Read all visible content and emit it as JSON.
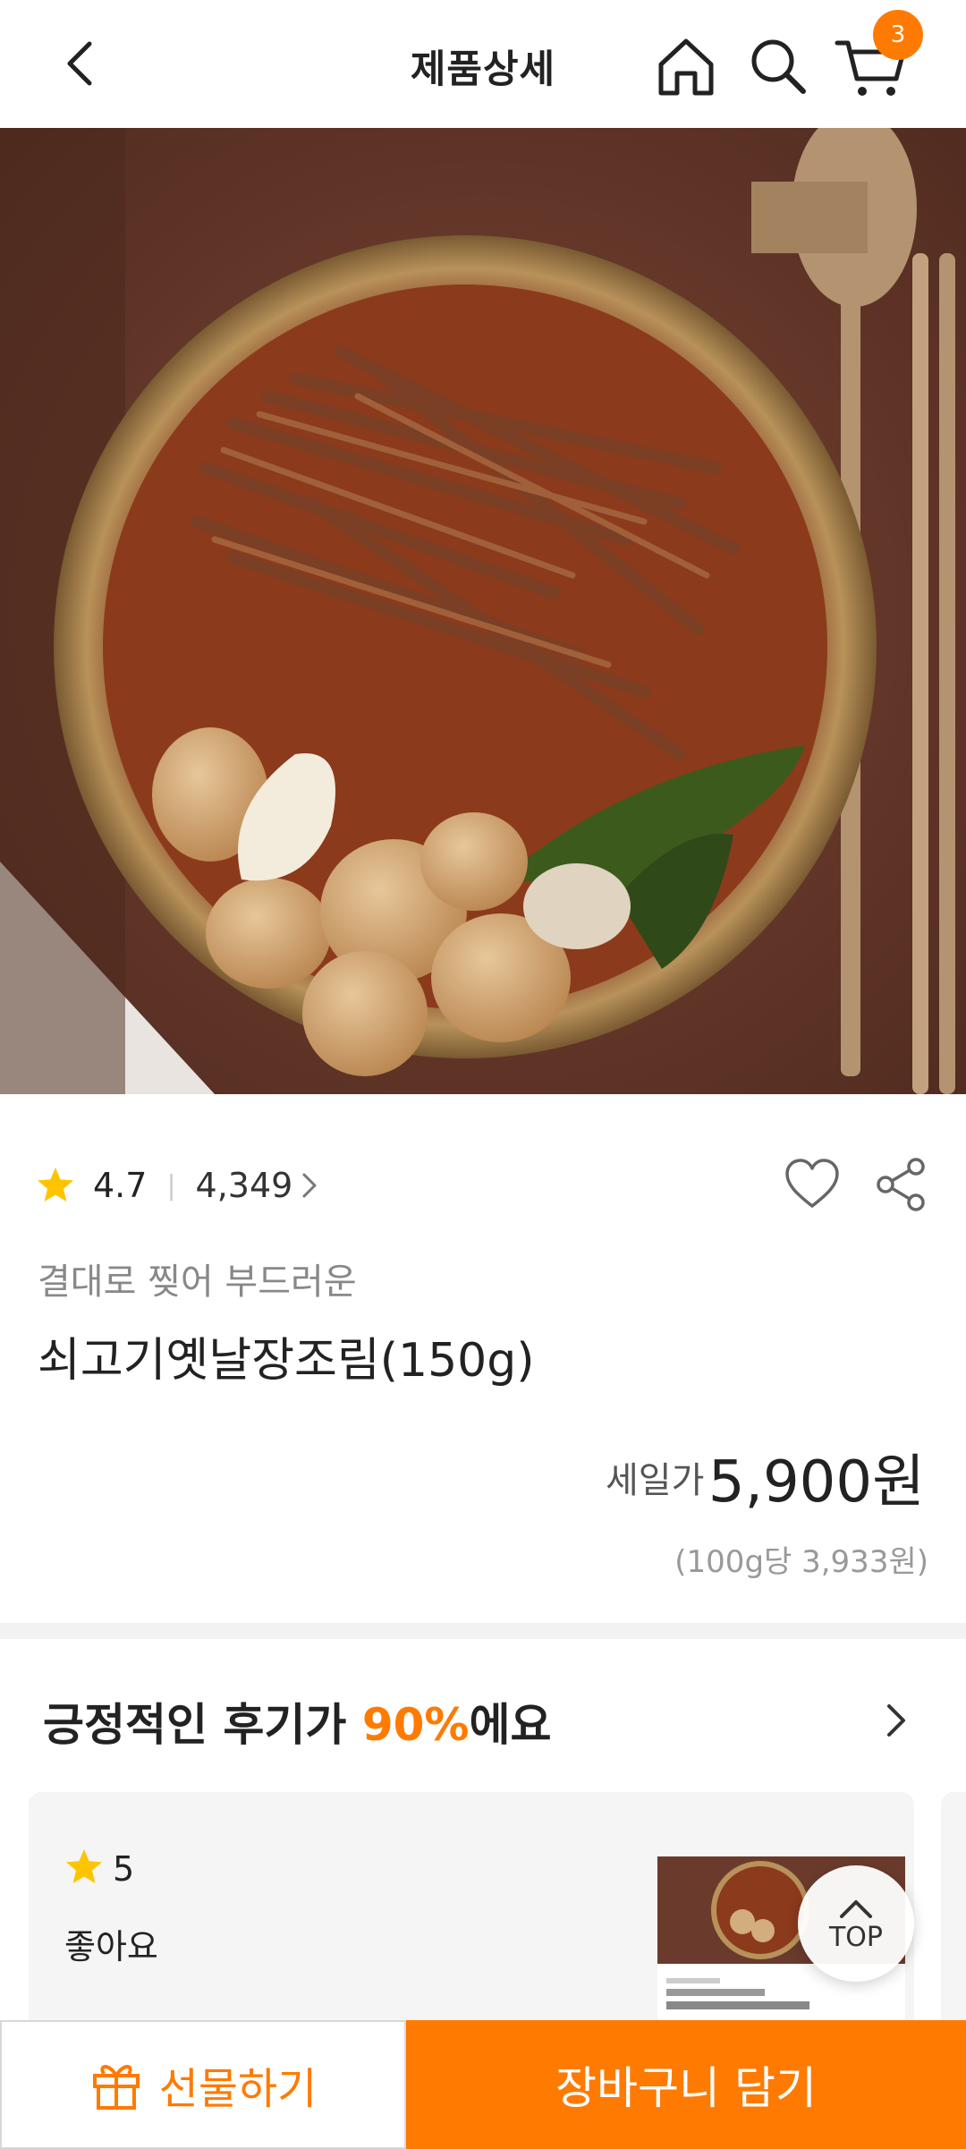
{
  "header": {
    "title": "제품상세",
    "cart_count": "3"
  },
  "product": {
    "rating": "4.7",
    "review_count": "4,349",
    "subtitle": "결대로 찢어 부드러운",
    "name": "쇠고기옛날장조림(150g)",
    "sale_label": "세일가",
    "price": "5,900원",
    "unit_price": "(100g당 3,933원)"
  },
  "reviews": {
    "title_prefix": "긍정적인 후기가 ",
    "title_percent": "90%",
    "title_suffix": "에요",
    "items": [
      {
        "score": "5",
        "text": "좋아요"
      }
    ]
  },
  "top_button": {
    "label": "TOP"
  },
  "bottom_bar": {
    "gift_label": "선물하기",
    "add_to_cart_label": "장바구니 담기"
  },
  "colors": {
    "accent": "#ff7a00",
    "star": "#ffc400"
  }
}
